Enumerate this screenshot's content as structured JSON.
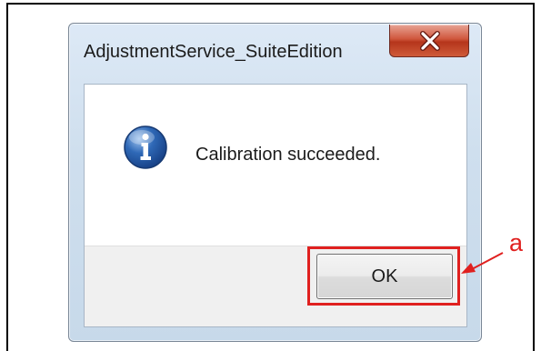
{
  "dialog": {
    "title": "AdjustmentService_SuiteEdition",
    "message": "Calibration succeeded.",
    "ok_label": "OK",
    "icon": "info-icon",
    "close_icon": "close-icon"
  },
  "annotation": {
    "label": "a",
    "color": "#e0201f"
  }
}
